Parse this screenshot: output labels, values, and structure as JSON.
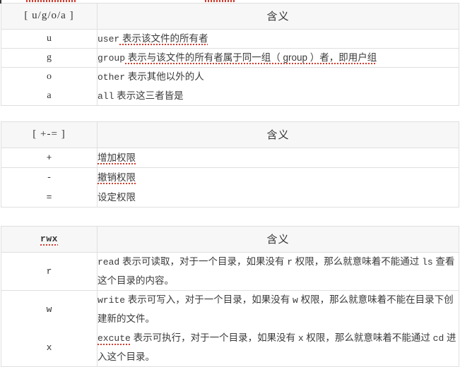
{
  "document": {
    "title": "Linux chmod permission reference tables",
    "accent_color": "#d23c2e",
    "header_bg": "#f7f7f7",
    "border_color": "#dfdfdf",
    "text_color": "#333333"
  },
  "tables": [
    {
      "id": "ugoa-table",
      "headers": {
        "key": "[ u/g/o/a ]",
        "meaning": "含义"
      },
      "rows": [
        {
          "key": "u",
          "mono_term": "user",
          "text": " 表示该文件的所有者"
        },
        {
          "key": "g",
          "mono_term": "group",
          "text": " 表示与该文件的所有者属于同一组（ group ）者，即用户组"
        },
        {
          "key": "o",
          "mono_term": "other",
          "text": " 表示其他以外的人"
        },
        {
          "key": "a",
          "mono_term": "all",
          "text": " 表示这三者皆是"
        }
      ]
    },
    {
      "id": "pme-table",
      "headers": {
        "key": "[ +-= ]",
        "meaning": "含义"
      },
      "rows": [
        {
          "key": "+",
          "text": "增加权限"
        },
        {
          "key": "-",
          "text": "撤销权限"
        },
        {
          "key": "=",
          "text": "设定权限"
        }
      ]
    },
    {
      "id": "rwx-table",
      "headers": {
        "key": "rwx",
        "meaning": "含义"
      },
      "rows": [
        {
          "key": "r",
          "mono_term": "read",
          "text_1": " 表示可读取，对于一个目录，如果没有 ",
          "inline_mono_1": "r",
          "text_2": " 权限，那么就意味着不能通过 ",
          "inline_mono_2": "ls",
          "text_3": " 查看这个目录的内容。"
        },
        {
          "key": "w",
          "mono_term": "write",
          "text_1": " 表示可写入，对于一个目录，如果没有 ",
          "inline_mono_1": "w",
          "text_2": " 权限，那么就意味着不能在目录下创建新的文件。",
          "inline_mono_2": "",
          "text_3": ""
        },
        {
          "key": "x",
          "mono_term": "excute",
          "text_1": " 表示可执行，对于一个目录，如果没有 ",
          "inline_mono_1": "x",
          "text_2": " 权限，那么就意味着不能通过 ",
          "inline_mono_2": "cd",
          "text_3": " 进入这个目录。"
        }
      ]
    }
  ]
}
